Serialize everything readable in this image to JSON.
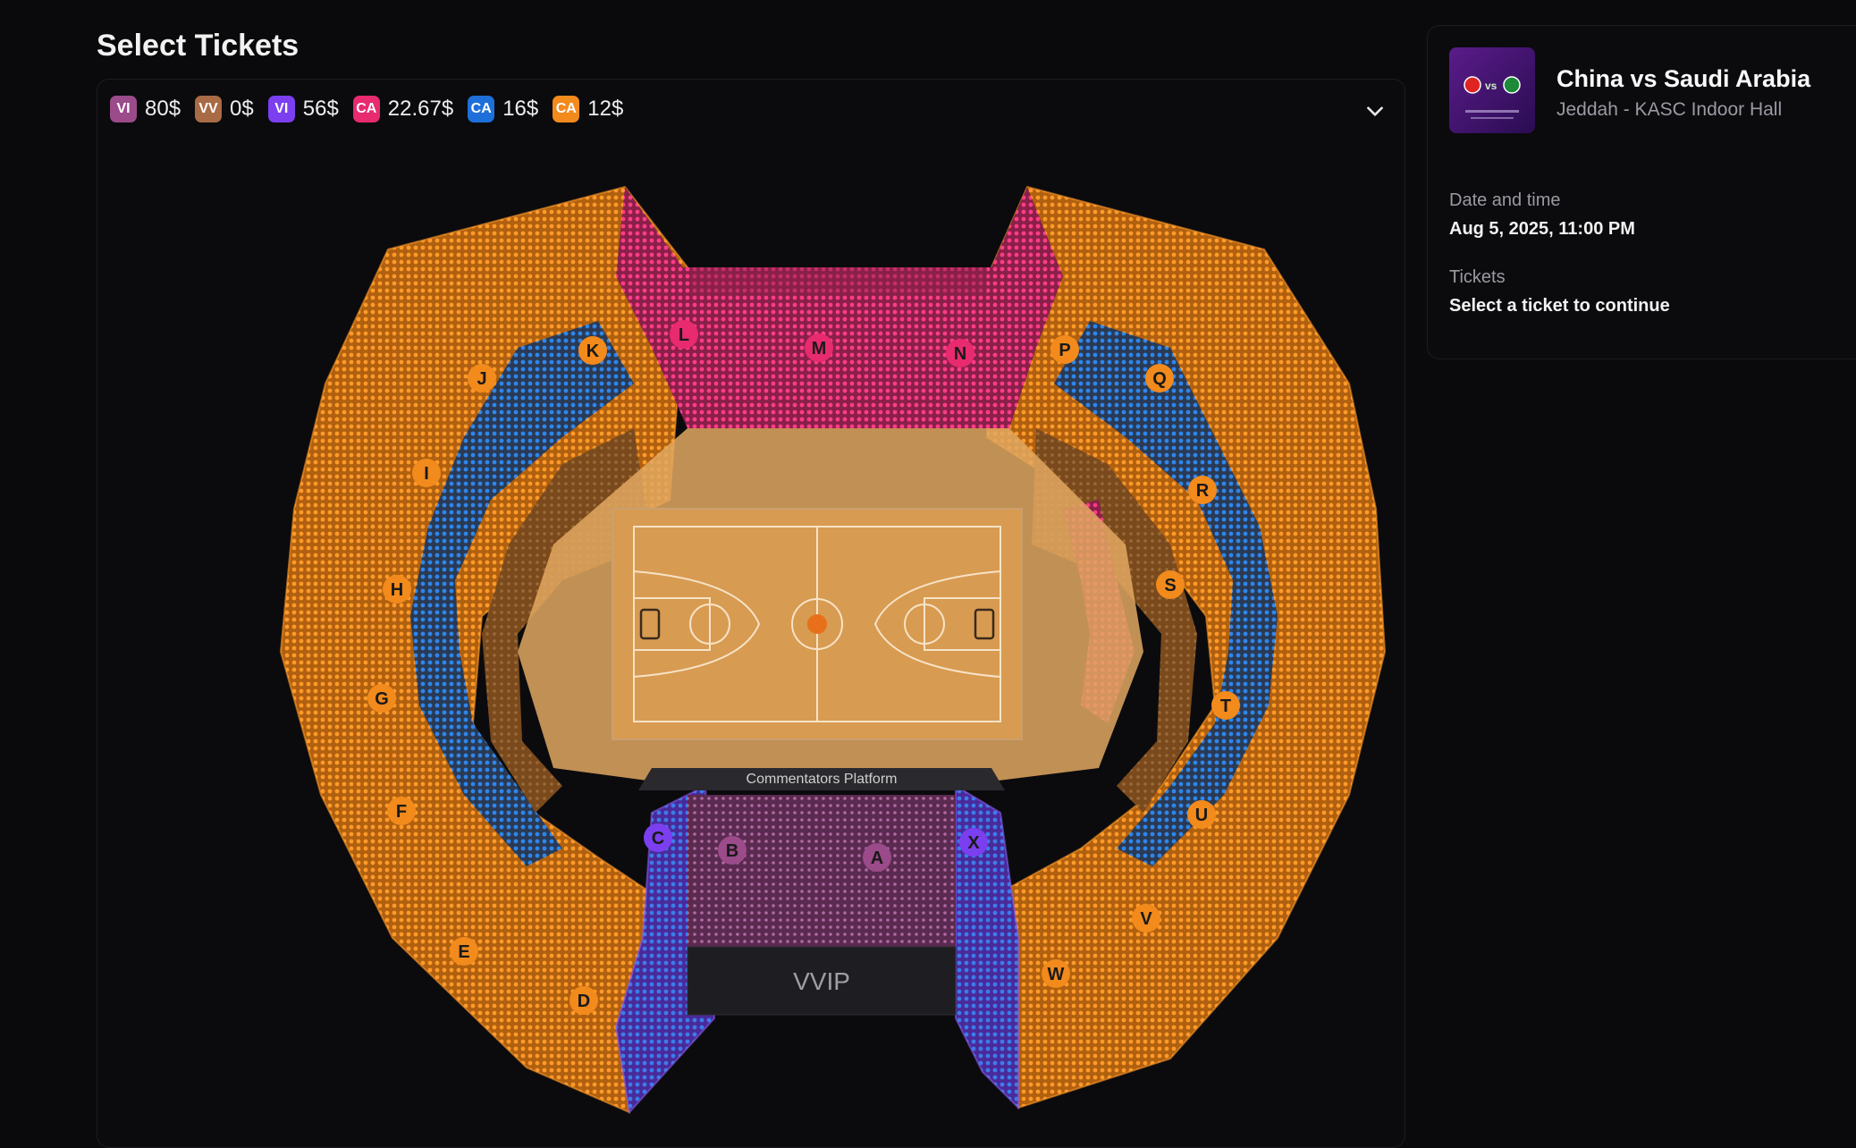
{
  "page": {
    "title": "Select Tickets"
  },
  "legend": [
    {
      "code": "VI",
      "price": "80$",
      "color": "#9b4a8a"
    },
    {
      "code": "VV",
      "price": "0$",
      "color": "#a86b45"
    },
    {
      "code": "VI",
      "price": "56$",
      "color": "#7b3ff0"
    },
    {
      "code": "CA",
      "price": "22.67$",
      "color": "#e82a6e"
    },
    {
      "code": "CA",
      "price": "16$",
      "color": "#1e6fd9"
    },
    {
      "code": "CA",
      "price": "12$",
      "color": "#f28a1c"
    }
  ],
  "colors": {
    "orange": "#f28a1c",
    "blue": "#1e6fd9",
    "pink": "#e82a6e",
    "purple": "#7b3ff0",
    "mauve": "#9b4a8a",
    "court": "#d89b52",
    "floor": "#e2a860"
  },
  "arena": {
    "sections": [
      "A",
      "B",
      "C",
      "D",
      "E",
      "F",
      "G",
      "H",
      "I",
      "J",
      "K",
      "L",
      "M",
      "N",
      "P",
      "Q",
      "R",
      "S",
      "T",
      "U",
      "V",
      "W",
      "X"
    ],
    "commentators_label": "Commentators Platform",
    "vvip_label": "VVIP"
  },
  "event": {
    "title": "China vs Saudi Arabia",
    "venue": "Jeddah - KASC Indoor Hall",
    "thumb_vs": "vs"
  },
  "details": {
    "date_label": "Date and time",
    "date_value": "Aug 5, 2025, 11:00 PM",
    "tickets_label": "Tickets",
    "tickets_value": "Select a ticket to continue"
  }
}
